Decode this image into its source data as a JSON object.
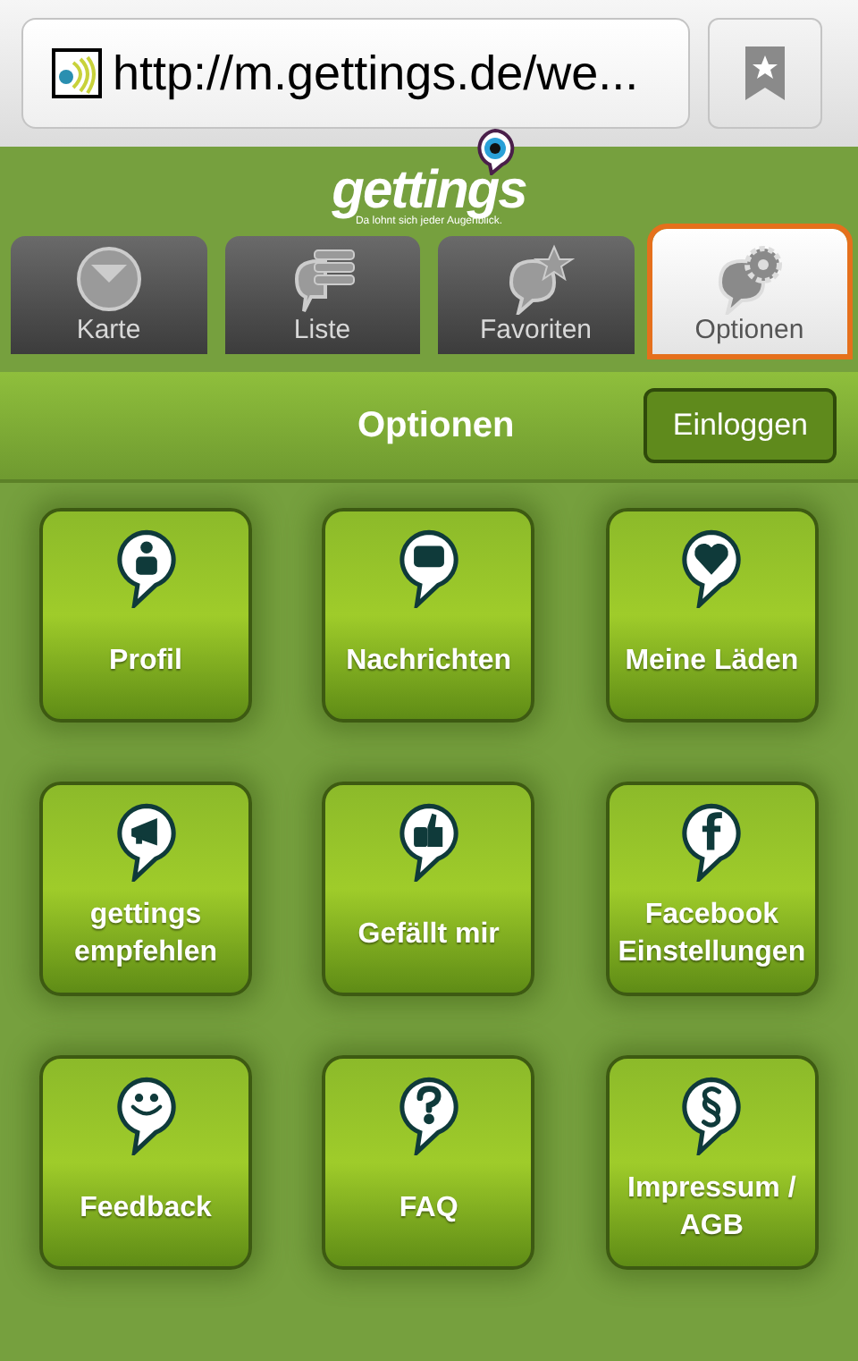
{
  "browser": {
    "url": "http://m.gettings.de/we..."
  },
  "logo": {
    "name": "gettings",
    "tagline": "Da lohnt sich jeder Augenblick."
  },
  "tabs": [
    {
      "label": "Karte",
      "selected": false
    },
    {
      "label": "Liste",
      "selected": false
    },
    {
      "label": "Favoriten",
      "selected": false
    },
    {
      "label": "Optionen",
      "selected": true
    }
  ],
  "header": {
    "title": "Optionen",
    "button": "Einloggen"
  },
  "tiles": [
    {
      "label": "Profil"
    },
    {
      "label": "Nachrichten"
    },
    {
      "label": "Meine Läden"
    },
    {
      "label": "gettings empfehlen"
    },
    {
      "label": "Gefällt mir"
    },
    {
      "label": "Facebook Einstellungen"
    },
    {
      "label": "Feedback"
    },
    {
      "label": "FAQ"
    },
    {
      "label": "Impressum / AGB"
    }
  ]
}
